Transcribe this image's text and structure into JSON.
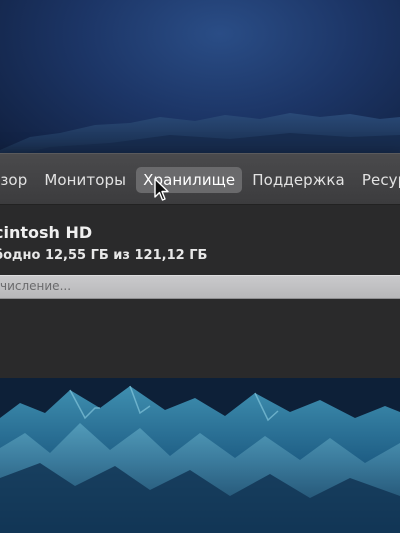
{
  "tabs": [
    {
      "label": "бзор",
      "active": false
    },
    {
      "label": "Мониторы",
      "active": false
    },
    {
      "label": "Хранилище",
      "active": true
    },
    {
      "label": "Поддержка",
      "active": false
    },
    {
      "label": "Ресурс",
      "active": false
    }
  ],
  "storage": {
    "disk_name": "cintosh HD",
    "free_text": "бодно 12,55 ГБ из 121,12 ГБ",
    "bar_status": "числение..."
  },
  "colors": {
    "window_bg": "#3a3a3c",
    "active_tab": "#6a6a6c",
    "bar": "#c4c4c6"
  },
  "icons": [
    "arrow-cursor-icon"
  ]
}
